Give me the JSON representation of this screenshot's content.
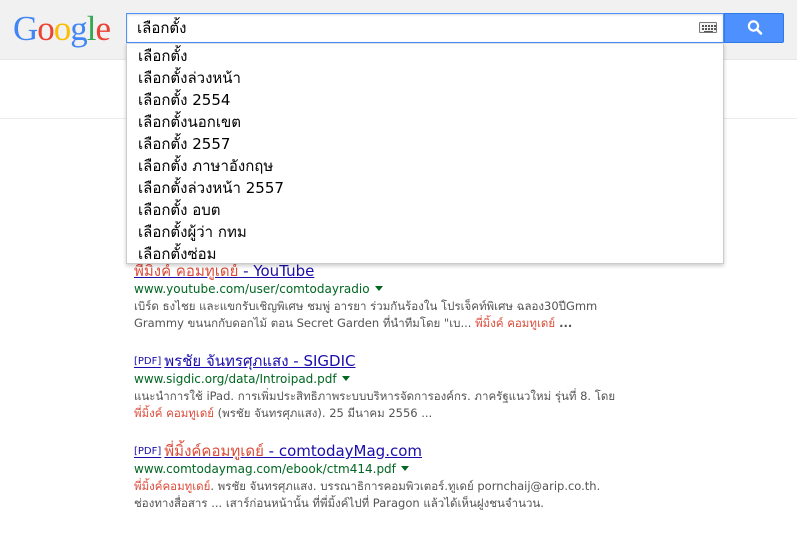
{
  "header": {
    "logo_letters": [
      {
        "ch": "G",
        "color": "#4285f4"
      },
      {
        "ch": "o",
        "color": "#ea4335"
      },
      {
        "ch": "o",
        "color": "#fbbc05"
      },
      {
        "ch": "g",
        "color": "#4285f4"
      },
      {
        "ch": "l",
        "color": "#34a853"
      },
      {
        "ch": "e",
        "color": "#ea4335"
      }
    ],
    "search_value": "เลือกตั้ง",
    "search_button_color": "#4d90fe",
    "icons": [
      "keyboard-icon",
      "search-icon"
    ]
  },
  "suggestions": [
    "เลือกตั้ง",
    "เลือกตั้งล่วงหน้า",
    "เลือกตั้ง 2554",
    "เลือกตั้งนอกเขต",
    "เลือกตั้ง 2557",
    "เลือกตั้ง ภาษาอังกฤษ",
    "เลือกตั้งล่วงหน้า 2557",
    "เลือกตั้ง อบต",
    "เลือกตั้งผู้ว่า กทม",
    "เลือกตั้งซ่อม"
  ],
  "results": [
    {
      "tag": "",
      "title_hl": "พี่มิ้งค์ คอมทูเดย์",
      "title_rest": " - YouTube",
      "url": "www.youtube.com/user/comtodayradio",
      "line1": "เบิร์ด ธงไชย และแขกรับเชิญพิเศษ ชมพู่ อารยา ร่วมกันร้องใน โปรเจ็คท์พิเศษ ฉลอง30ปีGmm",
      "line2_a": "Grammy ขนนกกับดอกไม้ ตอน Secret Garden ที่นำทีมโดย \"เบ... ",
      "line2_em": "พี่มิ้งค์ คอมทูเดย์",
      "line2_b": " ..."
    },
    {
      "tag": "[PDF]",
      "title_hl": "พรชัย จันทรศุภแสง",
      "title_rest": " - SIGDIC",
      "url": "www.sigdic.org/data/Introipad.pdf",
      "line1": "แนะนำการใช้ iPad. การเพิ่มประสิทธิภาพระบบบริหารจัดการองค์กร. ภาครัฐแนวใหม่ รุ่นที่ 8. โดย",
      "line2_a": "",
      "line2_em": "พี่มิ้งค์ คอมทูเดย์",
      "line2_b": " (พรชัย จันทรศุภแสง). 25 มีนาคม 2556 ..."
    },
    {
      "tag": "[PDF]",
      "title_hl": "พี่มิ้งค์คอมทูเดย์",
      "title_rest": " - comtodayMag.com",
      "url": "www.comtodaymag.com/ebook/ctm414.pdf",
      "line1_em": "พี่มิ้งค์คอมทูเดย์",
      "line1": ". พรชัย จันทรศุภแสง. บรรณาธิการคอมพิวเตอร์.ทูเดย์ pornchaij@arip.co.th.",
      "line2_a": "ช่องทางสื่อสาร ... เสาร์ก่อนหน้านั้น ที่พี่มิ้งค์ไปที่ Paragon แล้วได้เห็นฝูงชนจำนวน.",
      "line2_em": "",
      "line2_b": ""
    }
  ]
}
